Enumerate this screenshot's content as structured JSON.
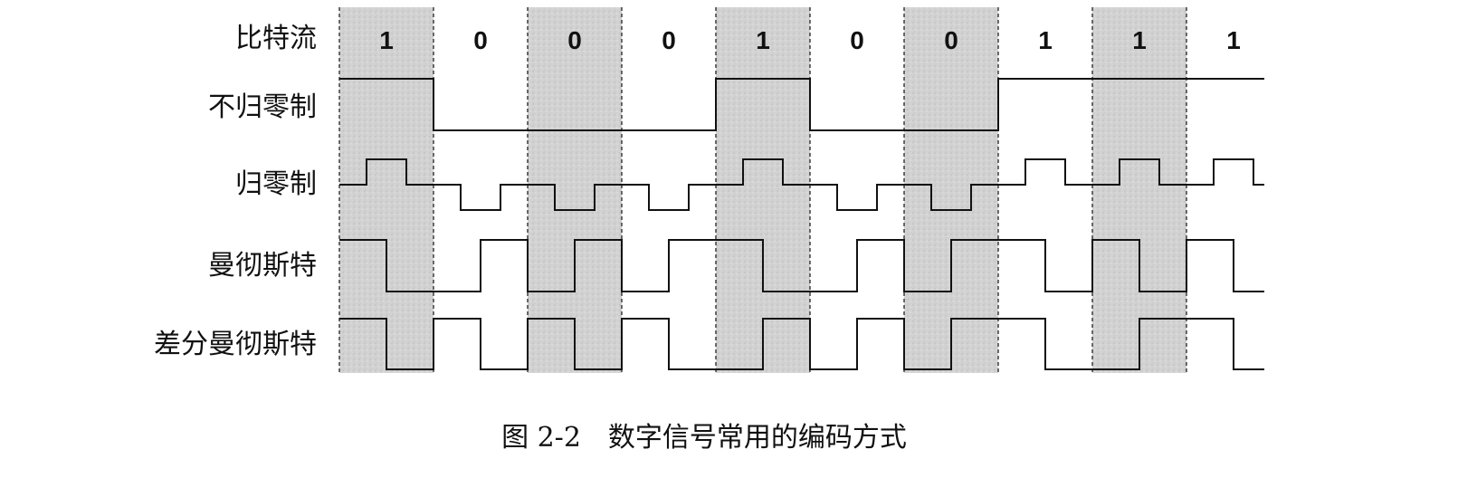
{
  "figure": {
    "bit_stream": [
      "1",
      "0",
      "0",
      "0",
      "1",
      "0",
      "0",
      "1",
      "1",
      "1"
    ],
    "row_labels": {
      "bits": "比特流",
      "nrz": "不归零制",
      "rz": "归零制",
      "manchester": "曼彻斯特",
      "diff_manchester": "差分曼彻斯特"
    },
    "caption": "图 2-2　数字信号常用的编码方式"
  },
  "colors": {
    "shade": "#cfcfcf",
    "line": "#111111"
  },
  "waveforms": {
    "nrz": "level per bit: 1 = high, 0 = low",
    "rz": "1 = positive pulse in bit center, 0 = negative pulse in bit center",
    "manchester": "1 = high-to-low at mid-bit, 0 = low-to-high at mid-bit",
    "diff_manchester": "always mid-bit transition; 0 = transition at bit start, 1 = no transition at bit start"
  }
}
